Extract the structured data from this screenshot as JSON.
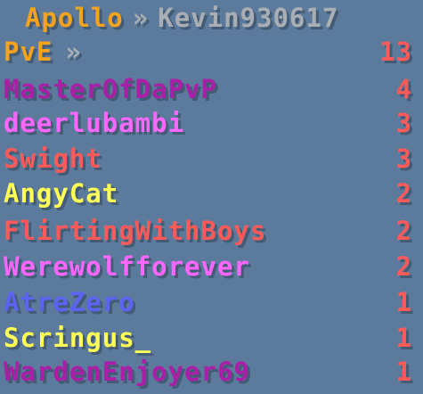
{
  "header": {
    "server": "Apollo",
    "separator": "»",
    "player": "Kevin930617"
  },
  "mode": {
    "label": "PvE",
    "separator": "»",
    "value": "13"
  },
  "entries": [
    {
      "name": "MasterOfDaPvP",
      "score": "4"
    },
    {
      "name": "deerlubambi",
      "score": "3"
    },
    {
      "name": "Swight",
      "score": "3"
    },
    {
      "name": "AngyCat",
      "score": "2"
    },
    {
      "name": "FlirtingWithBoys",
      "score": "2"
    },
    {
      "name": "Werewolfforever",
      "score": "2"
    },
    {
      "name": "AtreZero",
      "score": "1"
    },
    {
      "name": "Scringus_",
      "score": "1"
    },
    {
      "name": "WardenEnjoyer69",
      "score": "1"
    }
  ],
  "colors": {
    "background": "#5b7a9c",
    "server": "#f5a21e",
    "player": "#a8aeb4",
    "separator": "#a8aeb4",
    "mode": "#f5a21e",
    "score": "#ff5a5a",
    "purple": "#aa1ea8",
    "pink": "#ff66ff",
    "red": "#ff5a5a",
    "yellow": "#ffff55",
    "blue": "#5c63f2"
  }
}
